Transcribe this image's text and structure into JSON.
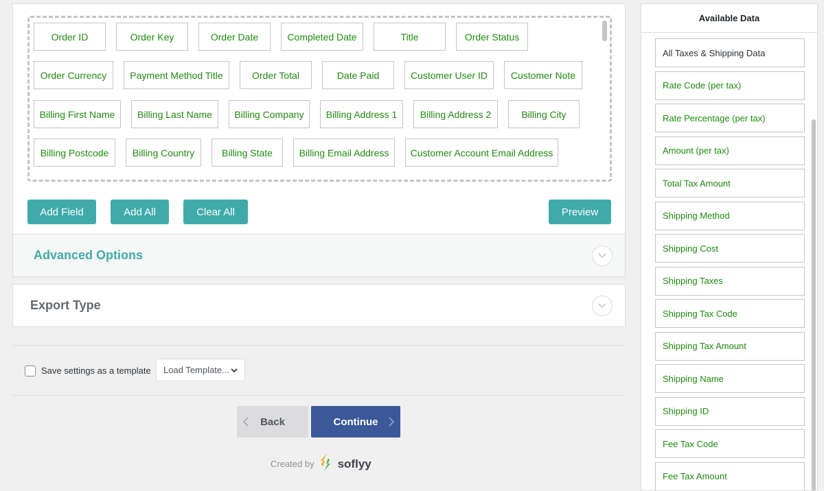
{
  "fields": {
    "row1": [
      "Order ID",
      "Order Key",
      "Order Date",
      "Completed Date",
      "Title",
      "Order Status"
    ],
    "row2": [
      "Order Currency",
      "Payment Method Title",
      "Order Total",
      "Date Paid",
      "Customer User ID",
      "Customer Note"
    ],
    "row3": [
      "Billing First Name",
      "Billing Last Name",
      "Billing Company",
      "Billing Address 1",
      "Billing Address 2",
      "Billing City"
    ],
    "row4": [
      "Billing Postcode",
      "Billing Country",
      "Billing State",
      "Billing Email Address",
      "Customer Account Email Address"
    ]
  },
  "actions": {
    "add_field": "Add Field",
    "add_all": "Add All",
    "clear_all": "Clear All",
    "preview": "Preview"
  },
  "sections": {
    "advanced": "Advanced Options",
    "export_type": "Export Type"
  },
  "template": {
    "save_label": "Save settings as a template",
    "load_placeholder": "Load Template..."
  },
  "navigation": {
    "back": "Back",
    "continue": "Continue"
  },
  "credit": {
    "text": "Created by",
    "brand": "soflyy"
  },
  "sidebar": {
    "title": "Available Data",
    "items": [
      "All Taxes & Shipping Data",
      "Rate Code (per tax)",
      "Rate Percentage (per tax)",
      "Amount (per tax)",
      "Total Tax Amount",
      "Shipping Method",
      "Shipping Cost",
      "Shipping Taxes",
      "Shipping Tax Code",
      "Shipping Tax Amount",
      "Shipping Name",
      "Shipping ID",
      "Fee Tax Code",
      "Fee Tax Amount"
    ]
  },
  "colors": {
    "teal": "#40aaaa",
    "field_green": "#1f8a0f",
    "continue_blue": "#3b5998"
  }
}
